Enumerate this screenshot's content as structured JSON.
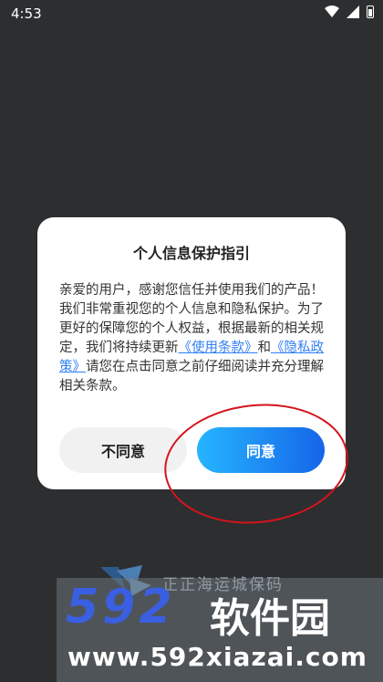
{
  "status_bar": {
    "time": "4:53",
    "icons": [
      "wifi-icon",
      "signal-icon",
      "battery-icon"
    ]
  },
  "dialog": {
    "title": "个人信息保护指引",
    "content_before": "亲爱的用户，感谢您信任并使用我们的产品！我们非常重视您的个人信息和隐私保护。为了更好的保障您的个人权益，根据最新的相关规定，我们将持续更新",
    "link_terms": "《使用条款》",
    "connector": "和",
    "link_privacy": "《隐私政策》",
    "content_after": "请您在点击同意之前仔细阅读并充分理解相关条款。",
    "disagree_label": "不同意",
    "agree_label": "同意"
  },
  "background": {
    "app_name_partial": "正正海运城保码"
  },
  "watermark": {
    "digits": "592",
    "name": "软件园",
    "url": "www.592xiazai.com"
  },
  "colors": {
    "agree_gradient_start": "#26b5ff",
    "agree_gradient_end": "#1565e8",
    "link": "#2f7ef5",
    "highlight_circle": "#d4141c"
  }
}
